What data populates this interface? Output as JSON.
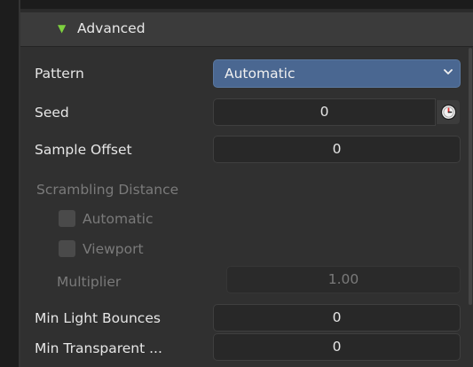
{
  "section": {
    "title": "Advanced"
  },
  "rows": {
    "pattern": {
      "label": "Pattern",
      "value": "Automatic"
    },
    "seed": {
      "label": "Seed",
      "value": "0"
    },
    "sample_offset": {
      "label": "Sample Offset",
      "value": "0"
    },
    "scrambling_distance": {
      "label": "Scrambling Distance",
      "automatic_label": "Automatic",
      "viewport_label": "Viewport",
      "multiplier_label": "Multiplier",
      "multiplier_value": "1.00"
    },
    "min_light_bounces": {
      "label": "Min Light Bounces",
      "value": "0"
    },
    "min_transparent": {
      "label": "Min Transparent ...",
      "value": "0"
    }
  },
  "colors": {
    "accent_triangle": "#7ed13f",
    "dropdown_selected": "#4a6791"
  },
  "icons": {
    "section_toggle": "disclosure-triangle-down",
    "dropdown_chevron": "chevron-down",
    "seed_random": "clock-dice"
  }
}
